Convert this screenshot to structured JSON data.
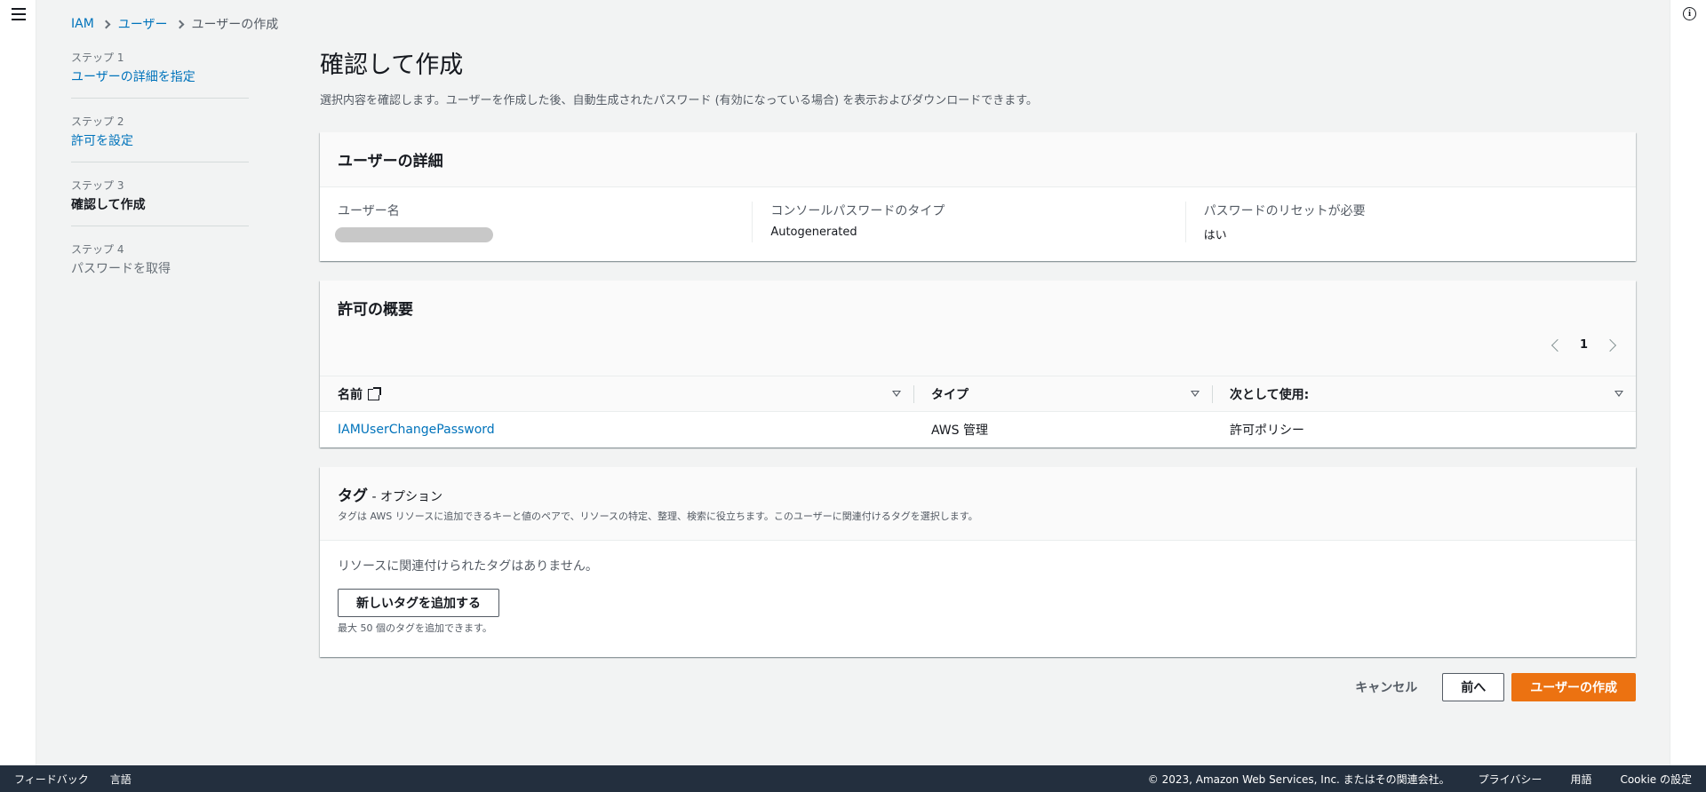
{
  "breadcrumb": {
    "items": [
      "IAM",
      "ユーザー",
      "ユーザーの作成"
    ]
  },
  "steps": [
    {
      "label": "ステップ 1",
      "title": "ユーザーの詳細を指定"
    },
    {
      "label": "ステップ 2",
      "title": "許可を設定"
    },
    {
      "label": "ステップ 3",
      "title": "確認して作成"
    },
    {
      "label": "ステップ 4",
      "title": "パスワードを取得"
    }
  ],
  "page": {
    "title": "確認して作成",
    "description": "選択内容を確認します。ユーザーを作成した後、自動生成されたパスワード (有効になっている場合) を表示およびダウンロードできます。"
  },
  "user_details": {
    "header": "ユーザーの詳細",
    "username_key": "ユーザー名",
    "password_type_key": "コンソールパスワードのタイプ",
    "password_type_value": "Autogenerated",
    "reset_key": "パスワードのリセットが必要",
    "reset_value": "はい"
  },
  "permissions": {
    "header": "許可の概要",
    "page_number": "1",
    "columns": [
      "名前",
      "タイプ",
      "次として使用:"
    ],
    "rows": [
      {
        "name": "IAMUserChangePassword",
        "type": "AWS 管理",
        "usage": "許可ポリシー"
      }
    ]
  },
  "tags": {
    "header": "タグ",
    "header_suffix": " - オプション",
    "description": "タグは AWS リソースに追加できるキーと値のペアで、リソースの特定、整理、検索に役立ちます。このユーザーに関連付けるタグを選択します。",
    "empty_text": "リソースに関連付けられたタグはありません。",
    "add_button": "新しいタグを追加する",
    "hint": "最大 50 個のタグを追加できます。"
  },
  "actions": {
    "cancel": "キャンセル",
    "previous": "前へ",
    "create": "ユーザーの作成"
  },
  "footer": {
    "feedback": "フィードバック",
    "language": "言語",
    "copyright": "© 2023, Amazon Web Services, Inc. またはその関連会社。",
    "privacy": "プライバシー",
    "terms": "用語",
    "cookie": "Cookie の設定"
  },
  "colors": {
    "primary": "#ec7211",
    "link": "#0073bb",
    "footer_bg": "#232f3e"
  }
}
